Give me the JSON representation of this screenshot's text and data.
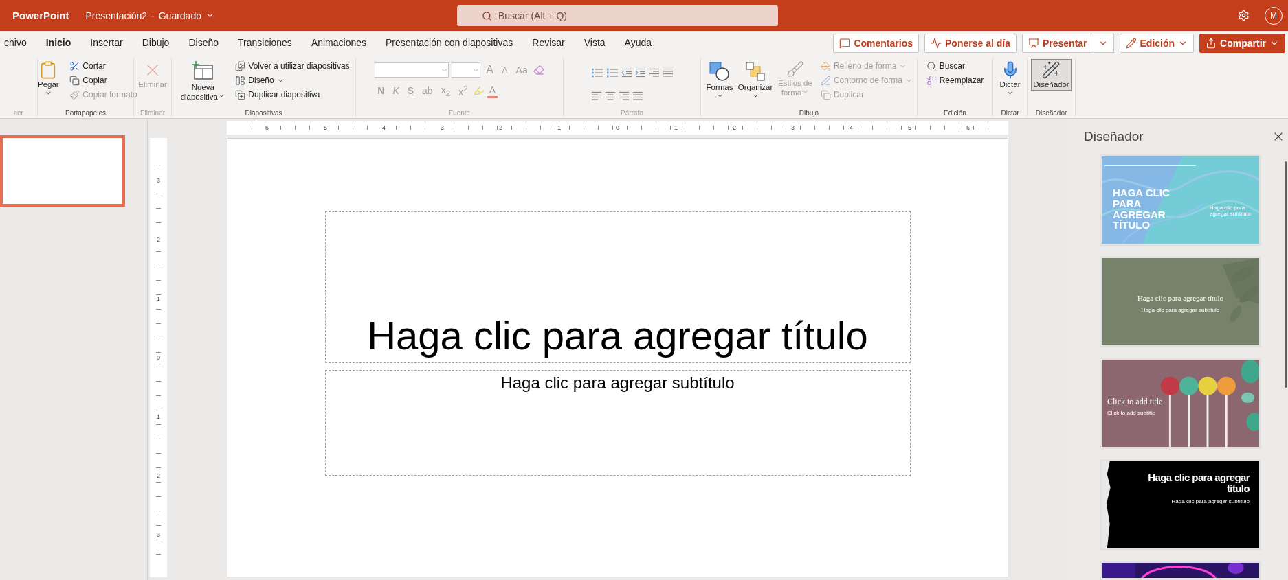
{
  "app_bar": {
    "app_name": "PowerPoint",
    "document": "Presentación2",
    "separator": "-",
    "save_state": "Guardado",
    "search": {
      "placeholder": "Buscar (Alt + Q)"
    },
    "avatar": "M"
  },
  "tabs": [
    {
      "label": "chivo",
      "selected": false
    },
    {
      "label": "Inicio",
      "selected": true
    },
    {
      "label": "Insertar",
      "selected": false
    },
    {
      "label": "Dibujo",
      "selected": false
    },
    {
      "label": "Diseño",
      "selected": false
    },
    {
      "label": "Transiciones",
      "selected": false
    },
    {
      "label": "Animaciones",
      "selected": false
    },
    {
      "label": "Presentación con diapositivas",
      "selected": false
    },
    {
      "label": "Revisar",
      "selected": false
    },
    {
      "label": "Vista",
      "selected": false
    },
    {
      "label": "Ayuda",
      "selected": false
    }
  ],
  "actions": [
    {
      "kind": "outline",
      "label": "Comentarios"
    },
    {
      "kind": "outline",
      "label": "Ponerse al día"
    },
    {
      "kind": "split",
      "label": "Presentar"
    },
    {
      "kind": "dropdown",
      "label": "Edición"
    },
    {
      "kind": "primary",
      "label": "Compartir"
    }
  ],
  "ribbon": [
    {
      "kind": "cut",
      "label": "cer",
      "disabled": true
    },
    {
      "kind": "clipboard",
      "label": "Portapapeles",
      "disabled": false,
      "large": [
        {
          "label": "Pegar",
          "disabled": false,
          "caret": true
        }
      ],
      "items": [
        {
          "label": "Cortar",
          "disabled": false,
          "caret": false
        },
        {
          "label": "Copiar",
          "disabled": false,
          "caret": false
        },
        {
          "label": "Copiar formato",
          "disabled": true,
          "caret": false
        }
      ]
    },
    {
      "kind": "delete",
      "label": "Eliminar",
      "disabled": true,
      "large": [
        {
          "label": "Eliminar",
          "disabled": true,
          "caret": false
        }
      ]
    },
    {
      "kind": "slides",
      "label": "Diapositivas",
      "disabled": false,
      "large": [
        {
          "label": "Nueva diapositiva",
          "disabled": false,
          "caret": true
        }
      ],
      "items": [
        {
          "label": "Volver a utilizar diapositivas",
          "disabled": false,
          "caret": false
        },
        {
          "label": "Diseño",
          "disabled": false,
          "caret": true
        },
        {
          "label": "Duplicar diapositiva",
          "disabled": false,
          "caret": false
        }
      ]
    },
    {
      "kind": "font",
      "label": "Fuente",
      "disabled": true,
      "size_buttons": [
        "A",
        "A",
        "Aa"
      ],
      "format_buttons": [
        "N",
        "K",
        "S",
        "ab",
        "x$_{2}$",
        "x$^{2}$"
      ],
      "color_button": "A"
    },
    {
      "kind": "paragraph",
      "label": "Párrafo",
      "disabled": true
    },
    {
      "kind": "drawing",
      "label": "Dibujo",
      "disabled": false,
      "large": [
        {
          "label": "Formas",
          "disabled": false,
          "caret": true
        },
        {
          "label": "Organizar",
          "disabled": false,
          "caret": true
        },
        {
          "label": "Estilos de forma",
          "disabled": true,
          "caret": true
        }
      ],
      "items": [
        {
          "label": "Relleno de forma",
          "disabled": true,
          "caret": true
        },
        {
          "label": "Contorno de forma",
          "disabled": true,
          "caret": true
        },
        {
          "label": "Duplicar",
          "disabled": true,
          "caret": false
        }
      ]
    },
    {
      "kind": "editing",
      "label": "Edición",
      "disabled": false,
      "items": [
        {
          "label": "Buscar",
          "disabled": false,
          "caret": false
        },
        {
          "label": "Reemplazar",
          "disabled": false,
          "caret": false
        }
      ]
    },
    {
      "kind": "dictate",
      "label": "Dictar",
      "disabled": false,
      "large": [
        {
          "label": "Dictar",
          "disabled": false,
          "caret": true
        }
      ]
    },
    {
      "kind": "designer",
      "label": "Diseñador",
      "disabled": false,
      "large": [
        {
          "label": "Diseñador",
          "disabled": false,
          "caret": false,
          "selected": true
        }
      ]
    }
  ],
  "slides": [
    {
      "selected": true
    }
  ],
  "ruler": {
    "horizontal": [
      "6",
      "5",
      "4",
      "3",
      "2",
      "1",
      "0",
      "1",
      "2",
      "3",
      "4",
      "5",
      "6"
    ],
    "vertical": [
      "3",
      "2",
      "1",
      "0",
      "1",
      "2",
      "3"
    ]
  },
  "slide": {
    "title": "Haga clic para agregar título",
    "subtitle": "Haga clic para agregar subtítulo"
  },
  "designer": {
    "title": "Diseñador",
    "designs": [
      {
        "kind": "marble",
        "title": "HAGA CLIC PARA AGREGAR TÍTULO",
        "subtitle": "Haga clic para agregar subtítulo"
      },
      {
        "kind": "sage",
        "title": "Haga clic para agregar título",
        "subtitle": "Haga clic para agregar subtítulo"
      },
      {
        "title": "Click to add title",
        "subtitle": "Click to add subtitle"
      },
      {
        "kind": "black",
        "title": "Haga clic para agregar título",
        "subtitle": "Haga clic para agregar subtítulo"
      },
      {
        "kind": "neon"
      }
    ]
  }
}
